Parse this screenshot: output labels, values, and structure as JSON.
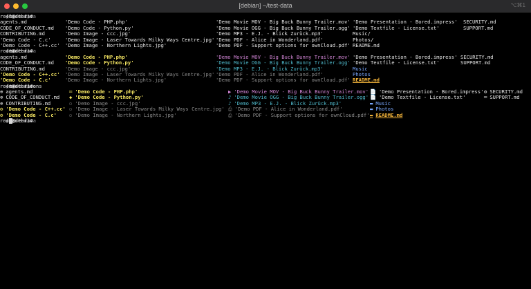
{
  "window": {
    "title": "[debian] ~/test-data",
    "shortcut": "⌥⌘1"
  },
  "prompt": {
    "user_host": "root@debian",
    "path": "~/test-data",
    "branch": "(master)#"
  },
  "commands": [
    "ls",
    "exa",
    "exa --icons"
  ],
  "ls": {
    "col1": [
      "agents.md",
      "CODE_OF_CONDUCT.md",
      "CONTRIBUTING.md",
      "'Demo Code - C.c'",
      "'Demo Code - C++.cc'"
    ],
    "col2": [
      "'Demo Code - PHP.php'",
      "'Demo Code - Python.py'",
      "'Demo Image - ccc.jpg'",
      "'Demo Image - Laser Towards Milky Ways Centre.jpg'",
      "'Demo Image - Northern Lights.jpg'"
    ],
    "col3": [
      "'Demo Movie MOV - Big Buck Bunny Trailer.mov'",
      "'Demo Movie OGG - Big Buck Bunny Trailer.ogg'",
      "'Demo MP3 - E.J. - Blick Zurück.mp3'",
      "'Demo PDF - Alice in Wonderland.pdf'",
      "'Demo PDF - Support options for ownCloud.pdf'"
    ],
    "col4": [
      "'Demo Presentation - Bored.impress'",
      "'Demo Textfile - License.txt'",
      "Music/",
      "Photos/",
      "README.md"
    ],
    "col5": [
      "SECURITY.md",
      "SUPPORT.md"
    ]
  },
  "exa": {
    "col1": [
      "agents.md",
      "CODE_OF_CONDUCT.md",
      "CONTRIBUTING.md",
      "'Demo Code - C++.cc'",
      "'Demo Code - C.c'"
    ],
    "col2": [
      "'Demo Code - PHP.php'",
      "'Demo Code - Python.py'",
      "'Demo Image - ccc.jpg'",
      "'Demo Image - Laser Towards Milky Ways Centre.jpg'",
      "'Demo Image - Northern Lights.jpg'"
    ],
    "col3": [
      "'Demo Movie MOV - Big Buck Bunny Trailer.mov'",
      "'Demo Movie OGG - Big Buck Bunny Trailer.ogg'",
      "'Demo MP3 - E.J. - Blick Zurück.mp3'",
      "'Demo PDF - Alice in Wonderland.pdf'",
      "'Demo PDF - Support options for ownCloud.pdf'"
    ],
    "col4": [
      "'Demo Presentation - Bored.impress'",
      "'Demo Textfile - License.txt'",
      "Music",
      "Photos",
      "README.md"
    ],
    "col5": [
      "SECURITY.md",
      "SUPPORT.md"
    ]
  },
  "icons": {
    "col1": [
      "⊕",
      "⊕",
      "⊕",
      "⚙",
      "⚙"
    ],
    "col2": [
      "═",
      "◆",
      "▫",
      "▫",
      "▫"
    ],
    "col3": [
      "▶",
      "♪",
      "♪",
      "⎙",
      "⎙"
    ],
    "col4": [
      "📄",
      "📄",
      "▬",
      "▬",
      "▬"
    ],
    "col5": [
      "⚙",
      "═"
    ]
  },
  "colors": {
    "yellow": "#f5e663",
    "magenta": "#d487d8",
    "cyan": "#4fb7c9",
    "grey": "#8a8a8a",
    "blue": "#7aa8ff",
    "orange": "#f2b33a"
  }
}
